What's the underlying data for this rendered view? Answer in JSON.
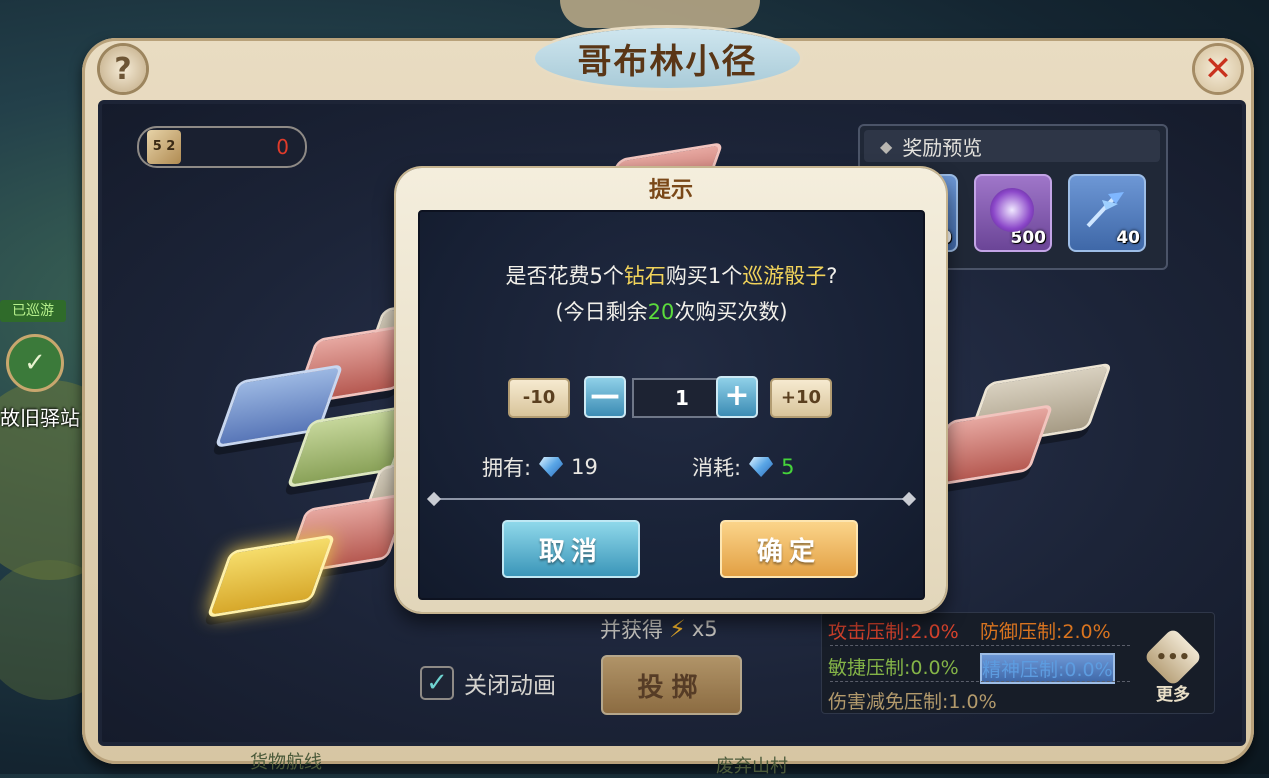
{
  "window": {
    "title": "哥布林小径"
  },
  "dice": {
    "face_label": "5 2",
    "count": "0"
  },
  "rewards": {
    "title": "奖励预览",
    "items": [
      {
        "icon": "partial-item-icon",
        "count": "0"
      },
      {
        "icon": "purple-gem-icon",
        "count": "500"
      },
      {
        "icon": "feather-wand-icon",
        "count": "40"
      }
    ]
  },
  "sidebar": {
    "tag": "已巡游",
    "label": "故旧驿站"
  },
  "map": {
    "bottom_left_label": "货物航线",
    "bottom_center_label": "废弃山村"
  },
  "bottom": {
    "gain_label": "并获得",
    "gain_mult": "x5",
    "anim_label": "关闭动画",
    "roll_label": "投掷"
  },
  "stats": {
    "attack": "攻击压制:2.0%",
    "defense": "防御压制:2.0%",
    "agility": "敏捷压制:0.0%",
    "spirit": "精神压制:0.0%",
    "damage": "伤害减免压制:1.0%",
    "more_label": "更多",
    "more_glyph": "•••"
  },
  "dialog": {
    "title": "提示",
    "msg1_a": "是否花费5个",
    "msg1_b": "钻石",
    "msg1_c": "购买1个",
    "msg1_d": "巡游骰子",
    "msg1_e": "?",
    "msg2_a": "(今日剩余",
    "msg2_b": "20",
    "msg2_c": "次购买次数)",
    "minus10": "-10",
    "minus": "—",
    "quantity": "1",
    "plus": "+",
    "plus10": "+10",
    "own_label": "拥有:",
    "own_value": "19",
    "cost_label": "消耗:",
    "cost_value": "5",
    "cancel": "取消",
    "confirm": "确定"
  },
  "icons": {
    "help": "?",
    "close": "✕",
    "check": "✓",
    "bolt": "⚡",
    "diamond_bullet": "◆"
  },
  "colors": {
    "accent_red": "#e03b2a",
    "highlight_yellow": "#f1d35a",
    "highlight_green": "#5bdb3c"
  }
}
